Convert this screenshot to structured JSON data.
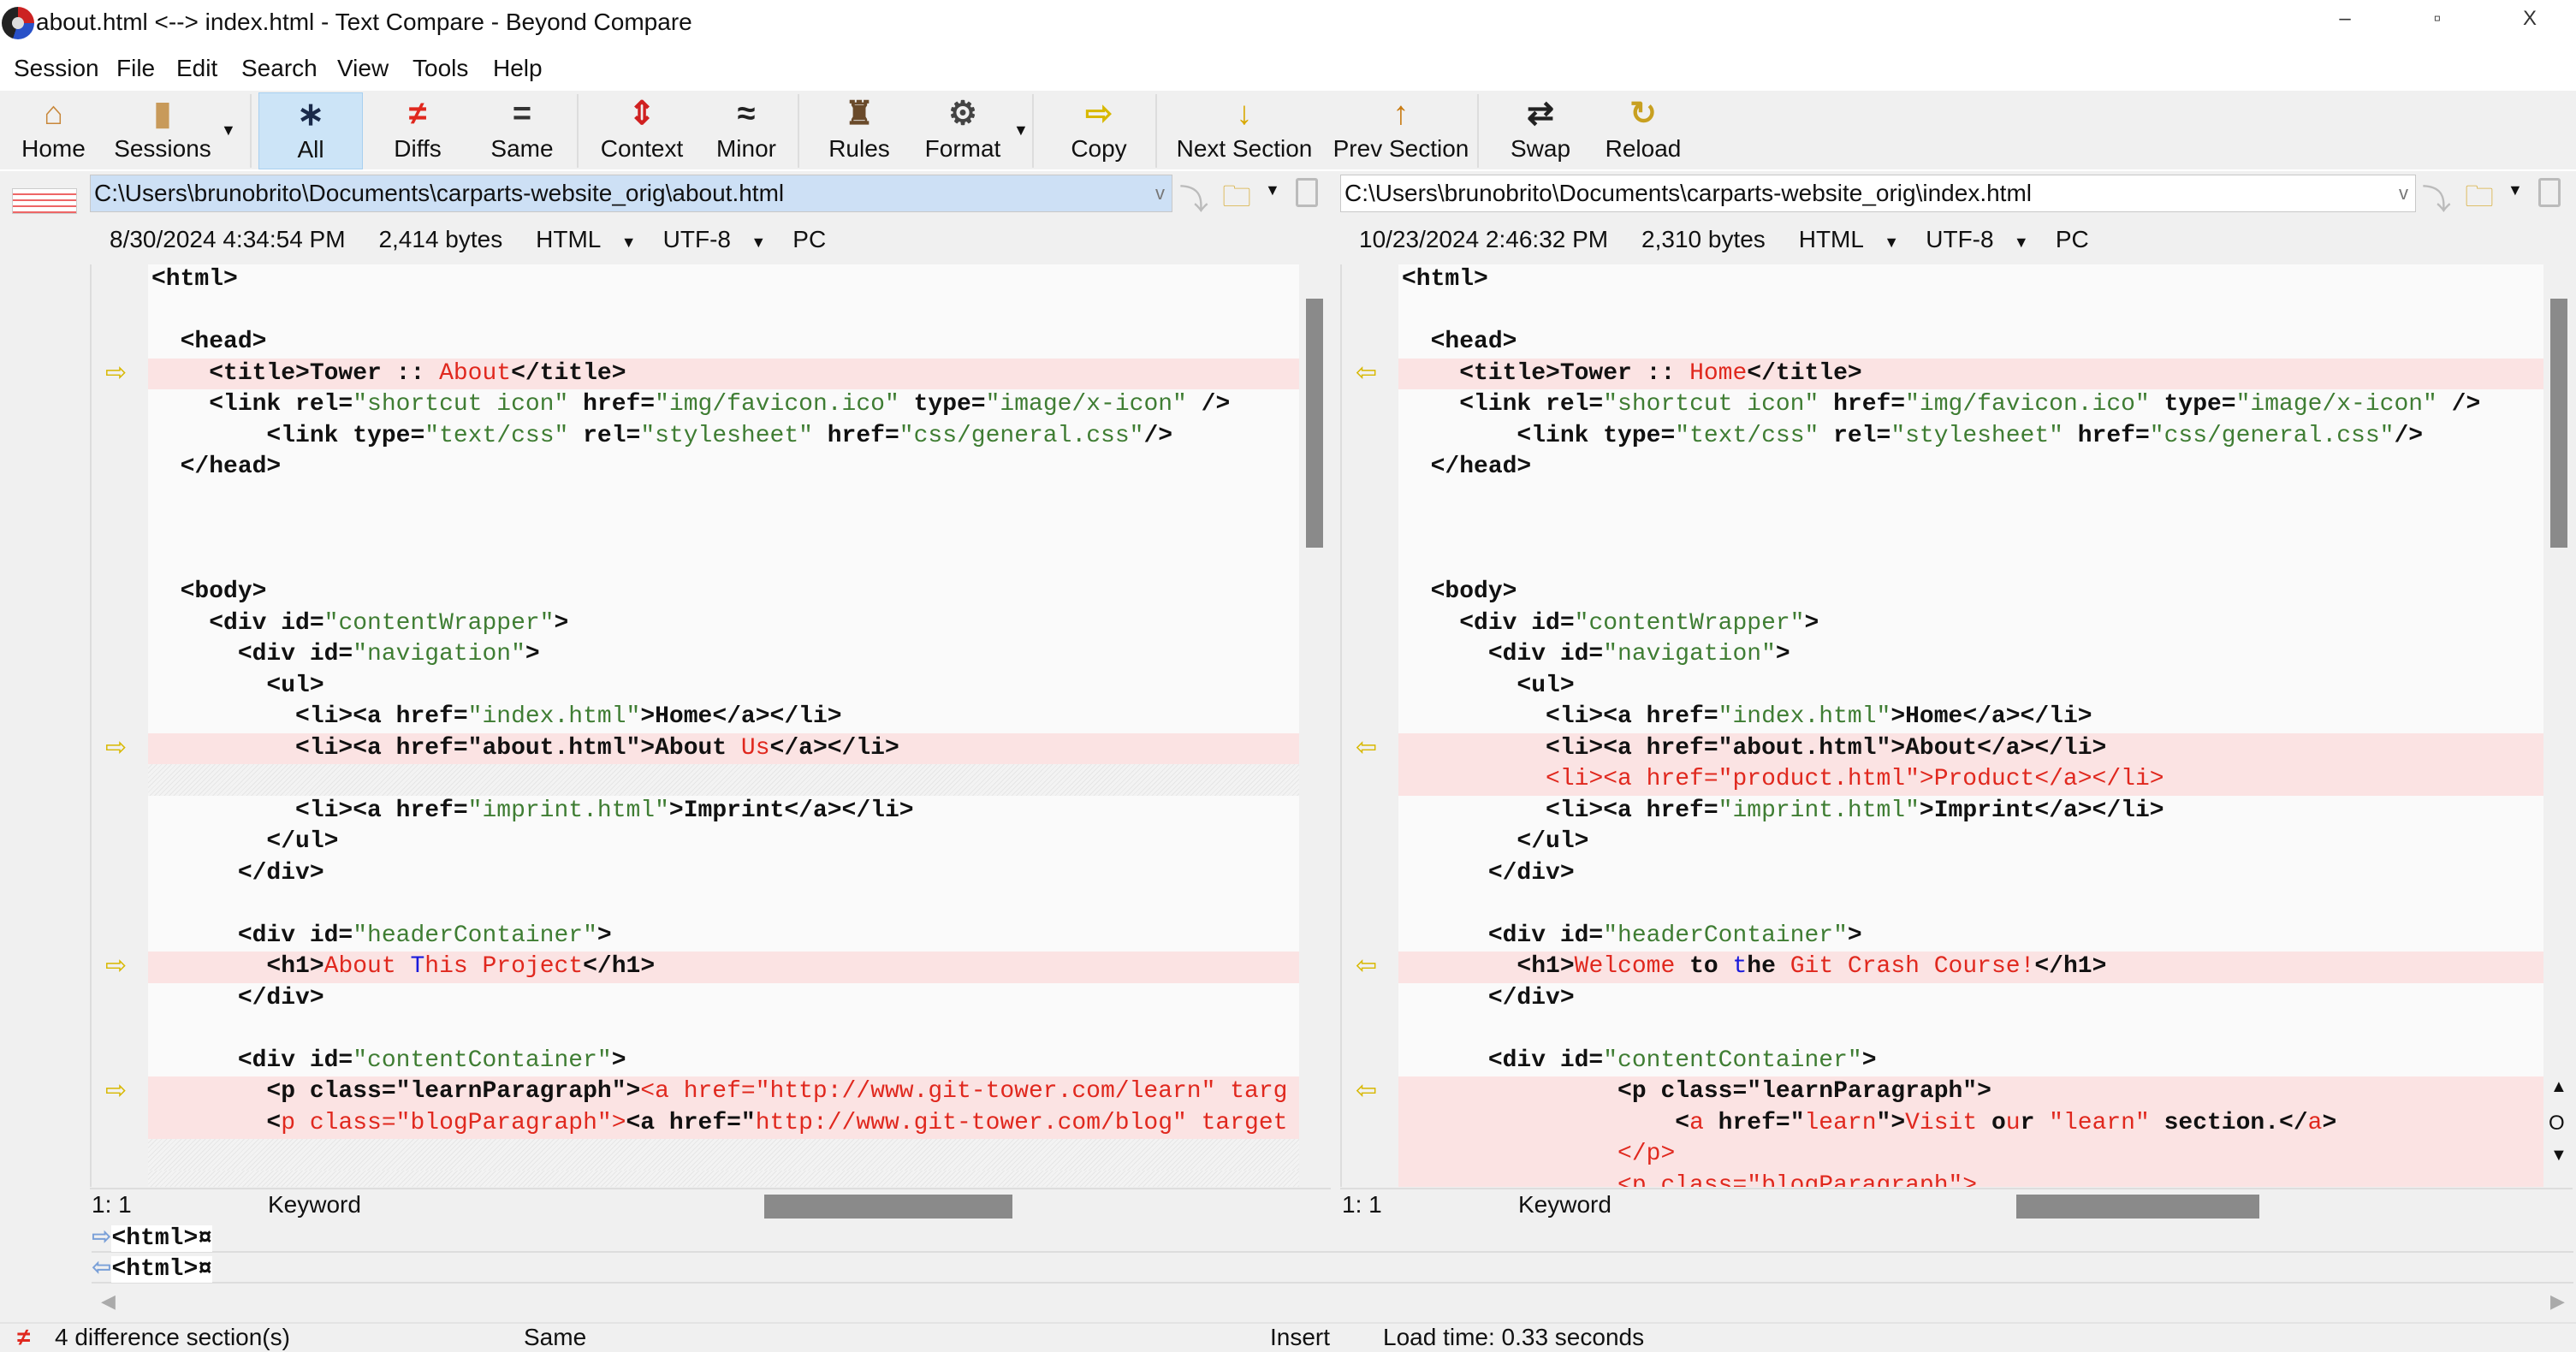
{
  "window": {
    "title": "about.html <--> index.html - Text Compare - Beyond Compare",
    "minimize": "–",
    "restore": "▫",
    "close": "X"
  },
  "menu": [
    "Session",
    "File",
    "Edit",
    "Search",
    "View",
    "Tools",
    "Help"
  ],
  "toolbar": [
    {
      "label": "Home",
      "icon": "home-icon",
      "glyph": "⌂",
      "color": "#c8873a"
    },
    {
      "label": "Sessions",
      "icon": "briefcase-icon",
      "glyph": "▮",
      "color": "#c89a5a"
    },
    {
      "label": "All",
      "icon": "asterisk-icon",
      "glyph": "∗",
      "color": "#1a2a4a"
    },
    {
      "label": "Diffs",
      "icon": "not-equal-icon",
      "glyph": "≠",
      "color": "#e0281e"
    },
    {
      "label": "Same",
      "icon": "equal-icon",
      "glyph": "=",
      "color": "#333"
    },
    {
      "label": "Context",
      "icon": "context-icon",
      "glyph": "⇕",
      "color": "#d02020"
    },
    {
      "label": "Minor",
      "icon": "approx-icon",
      "glyph": "≈",
      "color": "#222"
    },
    {
      "label": "Rules",
      "icon": "referee-icon",
      "glyph": "♜",
      "color": "#6a4a2a"
    },
    {
      "label": "Format",
      "icon": "format-gear-icon",
      "glyph": "⚙",
      "color": "#444"
    },
    {
      "label": "Copy",
      "icon": "arrow-right-icon",
      "glyph": "⇨",
      "color": "#d8b800"
    },
    {
      "label": "Next Section",
      "icon": "arrow-down-icon",
      "glyph": "↓",
      "color": "#d8a800"
    },
    {
      "label": "Prev Section",
      "icon": "arrow-up-icon",
      "glyph": "↑",
      "color": "#c87a10"
    },
    {
      "label": "Swap",
      "icon": "swap-icon",
      "glyph": "⇄",
      "color": "#222"
    },
    {
      "label": "Reload",
      "icon": "reload-icon",
      "glyph": "↻",
      "color": "#c8a020"
    }
  ],
  "left": {
    "path": "C:\\Users\\brunobrito\\Documents\\carparts-website_orig\\about.html",
    "date": "8/30/2024 4:34:54 PM",
    "size": "2,414 bytes",
    "format": "HTML",
    "encoding": "UTF-8",
    "lineend": "PC",
    "position": "1: 1",
    "mode": "Keyword",
    "lines": [
      {
        "s": [
          [
            "b",
            "<html>"
          ]
        ]
      },
      {
        "s": []
      },
      {
        "s": [
          [
            "b",
            "  <head>"
          ]
        ]
      },
      {
        "t": "diff",
        "s": [
          [
            "b",
            "    <title>Tower :: "
          ],
          [
            "r",
            "About"
          ],
          [
            "b",
            "</title>"
          ]
        ]
      },
      {
        "s": [
          [
            "b",
            "    <link rel="
          ],
          [
            "g",
            "\"shortcut icon\""
          ],
          [
            "b",
            " href="
          ],
          [
            "g",
            "\"img/favicon.ico\""
          ],
          [
            "b",
            " type="
          ],
          [
            "g",
            "\"image/x-icon\""
          ],
          [
            "b",
            " />"
          ]
        ]
      },
      {
        "s": [
          [
            "b",
            "        <link type="
          ],
          [
            "g",
            "\"text/css\""
          ],
          [
            "b",
            " rel="
          ],
          [
            "g",
            "\"stylesheet\""
          ],
          [
            "b",
            " href="
          ],
          [
            "g",
            "\"css/general.css\""
          ],
          [
            "b",
            "/>"
          ]
        ]
      },
      {
        "s": [
          [
            "b",
            "  </head>"
          ]
        ]
      },
      {
        "s": []
      },
      {
        "s": []
      },
      {
        "s": []
      },
      {
        "s": [
          [
            "b",
            "  <body>"
          ]
        ]
      },
      {
        "s": [
          [
            "b",
            "    <div id="
          ],
          [
            "g",
            "\"contentWrapper\""
          ],
          [
            "b",
            ">"
          ]
        ]
      },
      {
        "s": [
          [
            "b",
            "      <div id="
          ],
          [
            "g",
            "\"navigation\""
          ],
          [
            "b",
            ">"
          ]
        ]
      },
      {
        "s": [
          [
            "b",
            "        <ul>"
          ]
        ]
      },
      {
        "s": [
          [
            "b",
            "          <li><a href="
          ],
          [
            "g",
            "\"index.html\""
          ],
          [
            "b",
            ">Home</a></li>"
          ]
        ]
      },
      {
        "t": "diff",
        "s": [
          [
            "b",
            "          <li><a href=\"about.html\">About "
          ],
          [
            "r",
            "Us"
          ],
          [
            "b",
            "</a></li>"
          ]
        ]
      },
      {
        "t": "miss",
        "s": []
      },
      {
        "s": [
          [
            "b",
            "          <li><a href="
          ],
          [
            "g",
            "\"imprint.html\""
          ],
          [
            "b",
            ">Imprint</a></li>"
          ]
        ]
      },
      {
        "s": [
          [
            "b",
            "        </ul>"
          ]
        ]
      },
      {
        "s": [
          [
            "b",
            "      </div>"
          ]
        ]
      },
      {
        "s": []
      },
      {
        "s": [
          [
            "b",
            "      <div id="
          ],
          [
            "g",
            "\"headerContainer\""
          ],
          [
            "b",
            ">"
          ]
        ]
      },
      {
        "t": "diff",
        "s": [
          [
            "b",
            "        <h1>"
          ],
          [
            "r",
            "About"
          ],
          [
            "b",
            " "
          ],
          [
            "u",
            "T"
          ],
          [
            "r",
            "his Project"
          ],
          [
            "b",
            "</h1>"
          ]
        ]
      },
      {
        "s": [
          [
            "b",
            "      </div>"
          ]
        ]
      },
      {
        "s": []
      },
      {
        "s": [
          [
            "b",
            "      <div id="
          ],
          [
            "g",
            "\"contentContainer\""
          ],
          [
            "b",
            ">"
          ]
        ]
      },
      {
        "t": "diff",
        "s": [
          [
            "b",
            "        <p class=\"learnParagraph\">"
          ],
          [
            "r",
            "<a href=\"http://www.git-tower.com/learn\" targ"
          ]
        ]
      },
      {
        "t": "diff",
        "s": [
          [
            "b",
            "        <"
          ],
          [
            "r",
            "p class=\"blogParagraph\">"
          ],
          [
            "b",
            "<a href=\""
          ],
          [
            "r",
            "http://www.git-tower.com/blog\" target"
          ]
        ]
      },
      {
        "t": "miss",
        "s": []
      },
      {
        "t": "miss",
        "s": []
      }
    ]
  },
  "right": {
    "path": "C:\\Users\\brunobrito\\Documents\\carparts-website_orig\\index.html",
    "date": "10/23/2024 2:46:32 PM",
    "size": "2,310 bytes",
    "format": "HTML",
    "encoding": "UTF-8",
    "lineend": "PC",
    "position": "1: 1",
    "mode": "Keyword",
    "lines": [
      {
        "s": [
          [
            "b",
            "<html>"
          ]
        ]
      },
      {
        "s": []
      },
      {
        "s": [
          [
            "b",
            "  <head>"
          ]
        ]
      },
      {
        "t": "diff",
        "s": [
          [
            "b",
            "    <title>Tower :: "
          ],
          [
            "r",
            "Home"
          ],
          [
            "b",
            "</title>"
          ]
        ]
      },
      {
        "s": [
          [
            "b",
            "    <link rel="
          ],
          [
            "g",
            "\"shortcut icon\""
          ],
          [
            "b",
            " href="
          ],
          [
            "g",
            "\"img/favicon.ico\""
          ],
          [
            "b",
            " type="
          ],
          [
            "g",
            "\"image/x-icon\""
          ],
          [
            "b",
            " />"
          ]
        ]
      },
      {
        "s": [
          [
            "b",
            "        <link type="
          ],
          [
            "g",
            "\"text/css\""
          ],
          [
            "b",
            " rel="
          ],
          [
            "g",
            "\"stylesheet\""
          ],
          [
            "b",
            " href="
          ],
          [
            "g",
            "\"css/general.css\""
          ],
          [
            "b",
            "/>"
          ]
        ]
      },
      {
        "s": [
          [
            "b",
            "  </head>"
          ]
        ]
      },
      {
        "s": []
      },
      {
        "s": []
      },
      {
        "s": []
      },
      {
        "s": [
          [
            "b",
            "  <body>"
          ]
        ]
      },
      {
        "s": [
          [
            "b",
            "    <div id="
          ],
          [
            "g",
            "\"contentWrapper\""
          ],
          [
            "b",
            ">"
          ]
        ]
      },
      {
        "s": [
          [
            "b",
            "      <div id="
          ],
          [
            "g",
            "\"navigation\""
          ],
          [
            "b",
            ">"
          ]
        ]
      },
      {
        "s": [
          [
            "b",
            "        <ul>"
          ]
        ]
      },
      {
        "s": [
          [
            "b",
            "          <li><a href="
          ],
          [
            "g",
            "\"index.html\""
          ],
          [
            "b",
            ">Home</a></li>"
          ]
        ]
      },
      {
        "t": "diff",
        "s": [
          [
            "b",
            "          <li><a href=\"about.html\">About</a></li>"
          ]
        ]
      },
      {
        "t": "diff",
        "s": [
          [
            "b",
            "          "
          ],
          [
            "r",
            "<li><a href=\"product.html\">Product</a></li>"
          ]
        ]
      },
      {
        "s": [
          [
            "b",
            "          <li><a href="
          ],
          [
            "g",
            "\"imprint.html\""
          ],
          [
            "b",
            ">Imprint</a></li>"
          ]
        ]
      },
      {
        "s": [
          [
            "b",
            "        </ul>"
          ]
        ]
      },
      {
        "s": [
          [
            "b",
            "      </div>"
          ]
        ]
      },
      {
        "s": []
      },
      {
        "s": [
          [
            "b",
            "      <div id="
          ],
          [
            "g",
            "\"headerContainer\""
          ],
          [
            "b",
            ">"
          ]
        ]
      },
      {
        "t": "diff",
        "s": [
          [
            "b",
            "        <h1>"
          ],
          [
            "r",
            "Welcome"
          ],
          [
            "b",
            " to "
          ],
          [
            "u",
            "t"
          ],
          [
            "b",
            "he "
          ],
          [
            "r",
            "Git Crash Course!"
          ],
          [
            "b",
            "</h1>"
          ]
        ]
      },
      {
        "s": [
          [
            "b",
            "      </div>"
          ]
        ]
      },
      {
        "s": []
      },
      {
        "s": [
          [
            "b",
            "      <div id="
          ],
          [
            "g",
            "\"contentContainer\""
          ],
          [
            "b",
            ">"
          ]
        ]
      },
      {
        "t": "diff",
        "s": [
          [
            "b",
            "               <p class=\"learnParagraph\">"
          ]
        ]
      },
      {
        "t": "diff",
        "s": [
          [
            "b",
            "                   <"
          ],
          [
            "r",
            "a"
          ],
          [
            "b",
            " href=\""
          ],
          [
            "r",
            "learn"
          ],
          [
            "b",
            "\">"
          ],
          [
            "r",
            "Visit"
          ],
          [
            "b",
            " o"
          ],
          [
            "r",
            "u"
          ],
          [
            "b",
            "r "
          ],
          [
            "r",
            "\"learn\""
          ],
          [
            "b",
            " section.</"
          ],
          [
            "r",
            "a"
          ],
          [
            "b",
            ">"
          ]
        ]
      },
      {
        "t": "diff",
        "s": [
          [
            "r",
            "               </p>"
          ]
        ]
      },
      {
        "t": "diff",
        "s": [
          [
            "r",
            "               <p class=\"blogParagraph\">"
          ]
        ]
      }
    ]
  },
  "compare": {
    "left": "<html>¤",
    "right": "<html>¤"
  },
  "status": {
    "diff_count": "4 difference section(s)",
    "match": "Same",
    "mode": "Insert",
    "load_time": "Load time: 0.33 seconds"
  },
  "scroll_left": {
    "thumb_start": 0.0,
    "thumb_size": 0.28
  },
  "scroll_right": {
    "thumb_start": 0.0,
    "thumb_size": 0.28
  }
}
